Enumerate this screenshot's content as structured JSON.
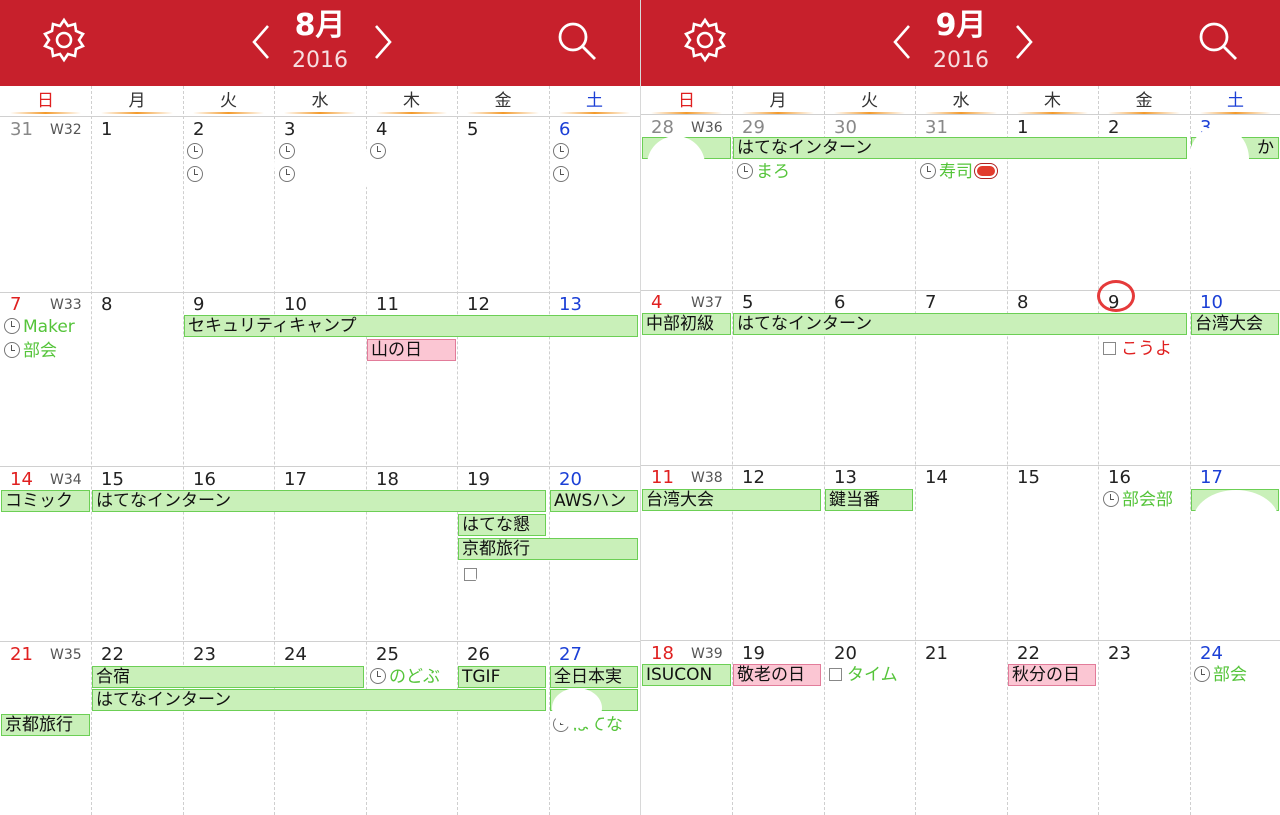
{
  "weekdays": [
    "日",
    "月",
    "火",
    "水",
    "木",
    "金",
    "土"
  ],
  "colors": {
    "header": "#c7202c",
    "sunday": "#e02020",
    "saturday": "#1b3fd6",
    "event_fill": "#c9f0b9",
    "holiday_fill": "#fbc6d3",
    "timed_text": "#55c43a"
  },
  "aug": {
    "month": "8月",
    "year": "2016",
    "weeks": [
      {
        "wk": "W32",
        "days": [
          "31",
          "1",
          "2",
          "3",
          "4",
          "5",
          "6"
        ]
      },
      {
        "wk": "W33",
        "days": [
          "7",
          "8",
          "9",
          "10",
          "11",
          "12",
          "13"
        ]
      },
      {
        "wk": "W34",
        "days": [
          "14",
          "15",
          "16",
          "17",
          "18",
          "19",
          "20"
        ]
      },
      {
        "wk": "W35",
        "days": [
          "21",
          "22",
          "23",
          "24",
          "25",
          "26",
          "27"
        ]
      }
    ],
    "events": {
      "maker": "Maker",
      "bukai": "部会",
      "seccamp": "セキュリティキャンプ",
      "yamanohi": "山の日",
      "comic": "コミック",
      "intern1": "はてなインターン",
      "aws": "AWSハン",
      "hatena_kon": "はてな懇",
      "kyoto1": "京都旅行",
      "gassyuku": "合宿",
      "nodobu": "のどぶ",
      "tgif": "TGIF",
      "zennihon": "全日本実",
      "intern2": "はてなインターン",
      "kyoto2": "京都旅行",
      "hatena_ev": "はてな"
    }
  },
  "sep": {
    "month": "9月",
    "year": "2016",
    "weeks": [
      {
        "wk": "W36",
        "days": [
          "28",
          "29",
          "30",
          "31",
          "1",
          "2",
          "3"
        ]
      },
      {
        "wk": "W37",
        "days": [
          "4",
          "5",
          "6",
          "7",
          "8",
          "9",
          "10"
        ]
      },
      {
        "wk": "W38",
        "days": [
          "11",
          "12",
          "13",
          "14",
          "15",
          "16",
          "17"
        ]
      },
      {
        "wk": "W39",
        "days": [
          "18",
          "19",
          "20",
          "21",
          "22",
          "23",
          "24"
        ]
      }
    ],
    "events": {
      "intern1": "はてなインターン",
      "ka": "か",
      "maro": "まろ",
      "sushi": "寿司",
      "chubu": "中部初級",
      "intern2": "はてなインターン",
      "taiwan1": "台湾大会",
      "kouyo": "こうよ",
      "taiwan2": "台湾大会",
      "kagitoban": "鍵当番",
      "bukaibu": "部会部",
      "isucon": "ISUCON",
      "keiro": "敬老の日",
      "time": "タイム",
      "shubun": "秋分の日",
      "bukai": "部会"
    }
  }
}
